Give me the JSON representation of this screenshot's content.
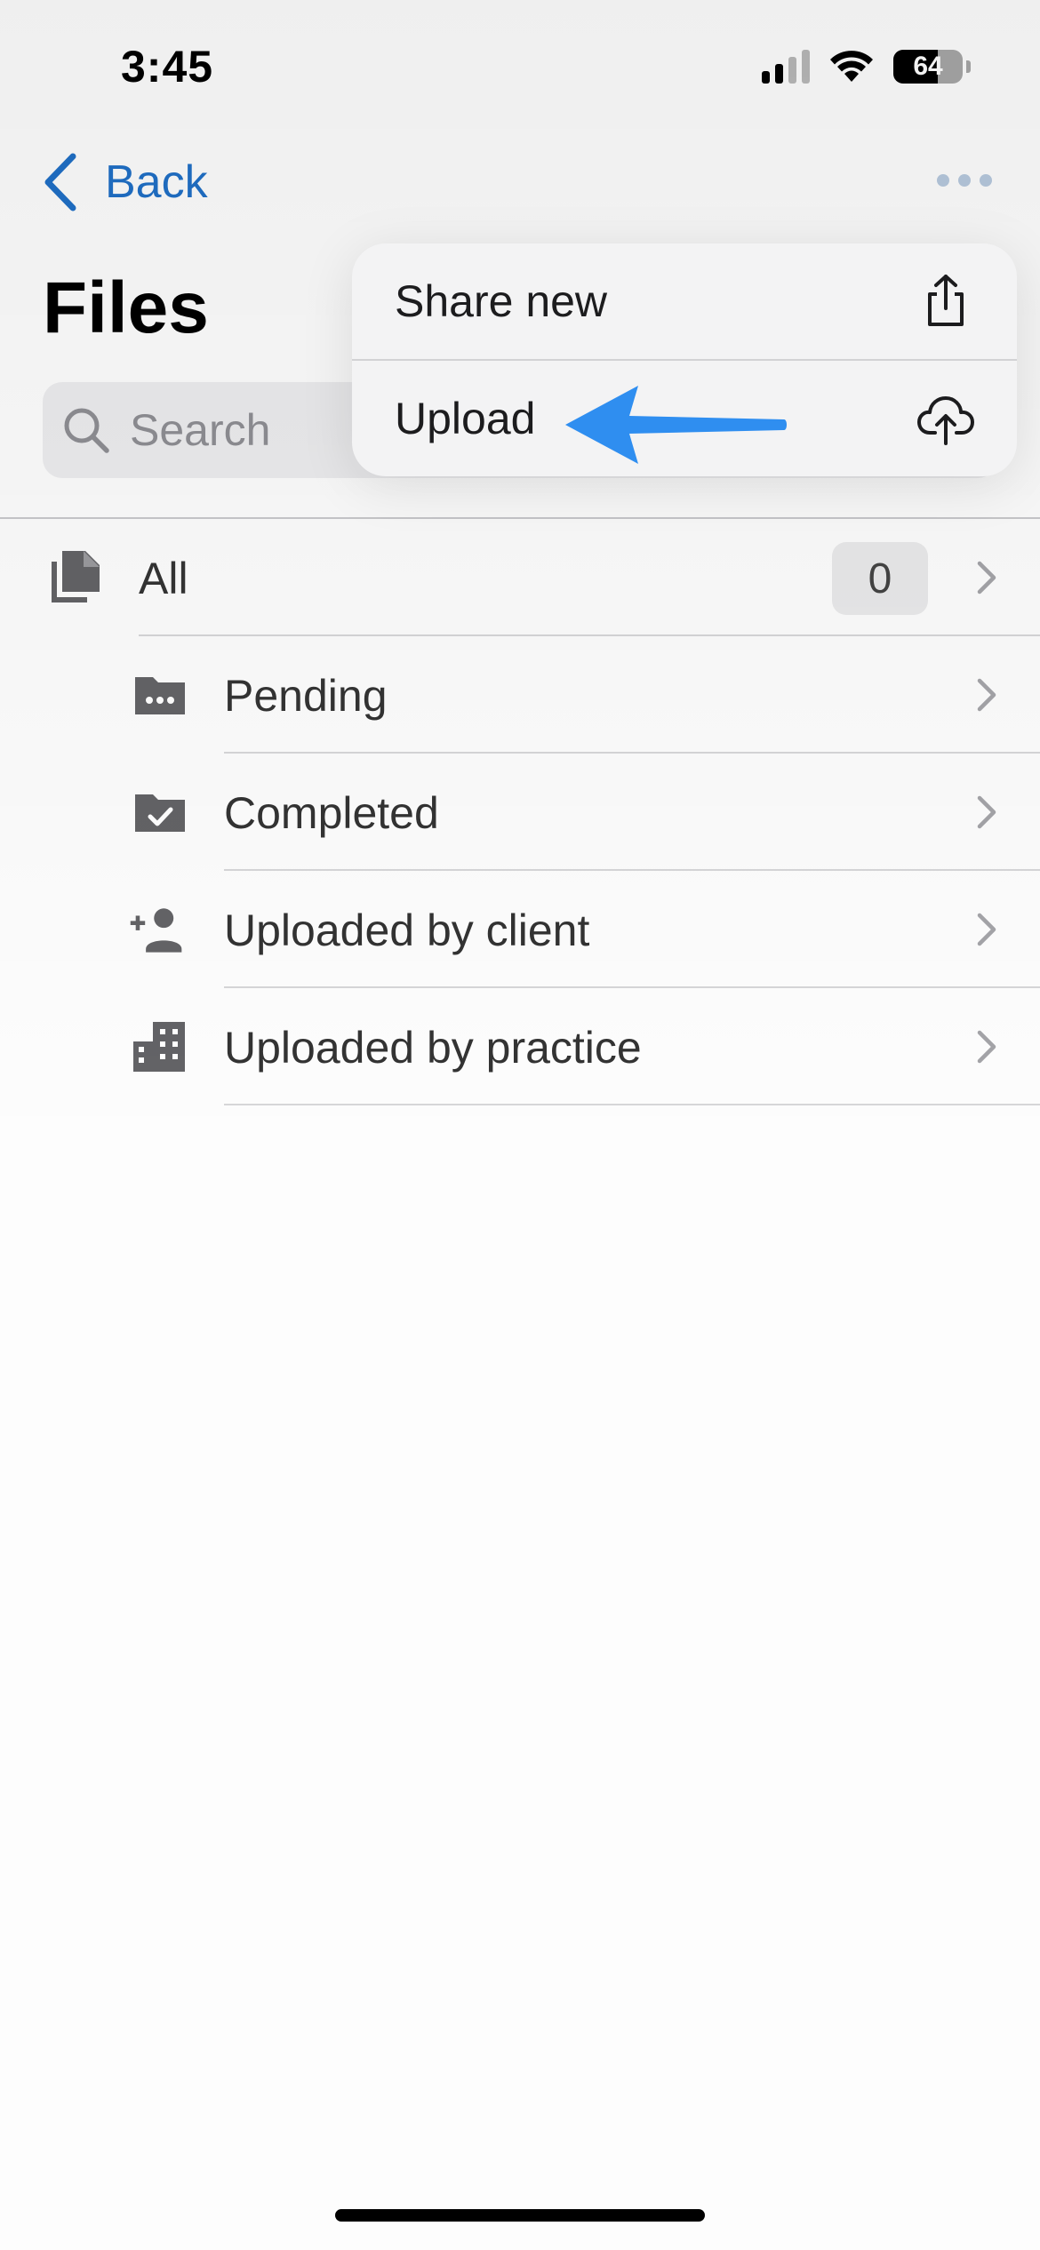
{
  "status_bar": {
    "time": "3:45",
    "battery_percent": "64",
    "battery_level": 0.64,
    "signal_bars": 2,
    "icons": [
      "cellular-signal-icon",
      "wifi-icon",
      "battery-icon"
    ]
  },
  "nav": {
    "back_label": "Back",
    "more_icon": "ellipsis-icon"
  },
  "page": {
    "title": "Files"
  },
  "search": {
    "placeholder": "Search",
    "icon": "search-icon"
  },
  "menu": {
    "items": [
      {
        "label": "Share new",
        "icon": "share-icon"
      },
      {
        "label": "Upload",
        "icon": "cloud-upload-icon"
      }
    ]
  },
  "list": {
    "all": {
      "label": "All",
      "count": "0",
      "icon": "documents-icon"
    },
    "items": [
      {
        "label": "Pending",
        "icon": "folder-pending-icon"
      },
      {
        "label": "Completed",
        "icon": "folder-check-icon"
      },
      {
        "label": "Uploaded by client",
        "icon": "person-add-icon"
      },
      {
        "label": "Uploaded by practice",
        "icon": "building-icon"
      }
    ]
  },
  "colors": {
    "accent": "#1f6fc6",
    "annotation_arrow": "#2f8ef0",
    "icon_gray": "#636366"
  }
}
